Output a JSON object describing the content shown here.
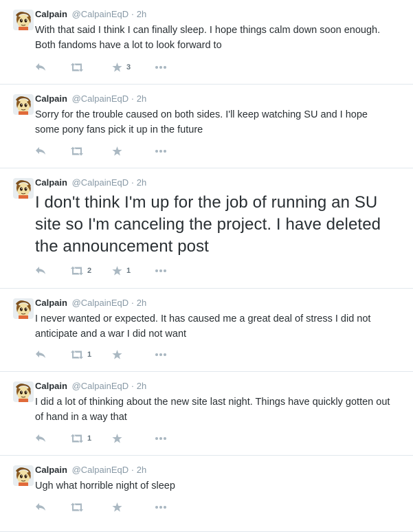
{
  "tweets": [
    {
      "name": "Calpain",
      "handle": "@CalpainEqD",
      "separator": "·",
      "time": "2h",
      "text": "With that said I think I can finally sleep. I hope things calm down soon enough. Both fandoms have a lot to look forward to",
      "retweets": "",
      "favorites": "3"
    },
    {
      "name": "Calpain",
      "handle": "@CalpainEqD",
      "separator": "·",
      "time": "2h",
      "text": "Sorry for the trouble caused on both sides. I'll keep watching SU and I hope some pony fans pick it up in the future",
      "retweets": "",
      "favorites": ""
    },
    {
      "name": "Calpain",
      "handle": "@CalpainEqD",
      "separator": "·",
      "time": "2h",
      "text": "I don't think I'm up for the job of running an SU site so I'm canceling the project. I have deleted the announcement post",
      "retweets": "2",
      "favorites": "1"
    },
    {
      "name": "Calpain",
      "handle": "@CalpainEqD",
      "separator": "·",
      "time": "2h",
      "text": "I never wanted or expected. It has caused me a great deal of stress I did not anticipate and a war I did not want",
      "retweets": "1",
      "favorites": ""
    },
    {
      "name": "Calpain",
      "handle": "@CalpainEqD",
      "separator": "·",
      "time": "2h",
      "text": "I did a lot of thinking about the new site last night. Things have quickly gotten out of hand in a way that",
      "retweets": "1",
      "favorites": ""
    },
    {
      "name": "Calpain",
      "handle": "@CalpainEqD",
      "separator": "·",
      "time": "2h",
      "text": "Ugh what horrible night of sleep",
      "retweets": "",
      "favorites": ""
    }
  ],
  "colors": {
    "icon": "#aab8c2",
    "meta": "#8899a6",
    "text": "#292f33",
    "divider": "#e1e8ed"
  }
}
